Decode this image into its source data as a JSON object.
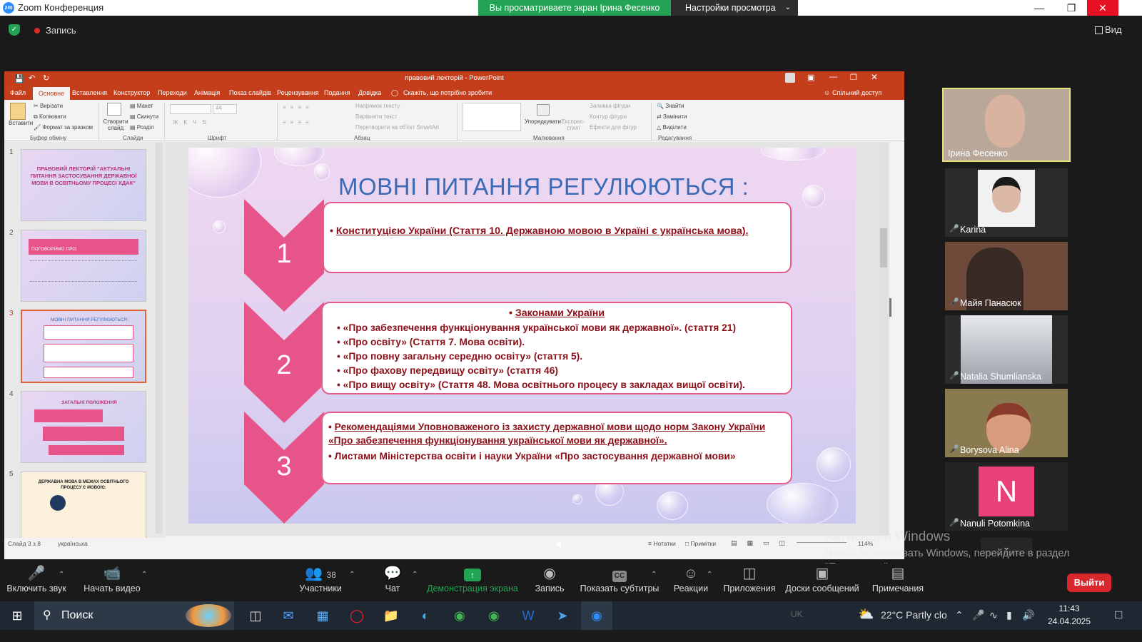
{
  "zoom": {
    "window_title": "Zoom Конференция",
    "share_banner": "Вы просматриваете экран Ірина Фесенко",
    "view_options": "Настройки просмотра",
    "record_label": "Запись",
    "view_label": "Вид",
    "leave_label": "Выйти",
    "toolbar": [
      {
        "label": "Включить звук",
        "icon": "microphone-muted-icon"
      },
      {
        "label": "Начать видео",
        "icon": "camera-off-icon"
      },
      {
        "label": "Участники",
        "icon": "participants-icon",
        "count": "38"
      },
      {
        "label": "Чат",
        "icon": "chat-icon"
      },
      {
        "label": "Демонстрация экрана",
        "icon": "share-screen-icon"
      },
      {
        "label": "Запись",
        "icon": "record-icon"
      },
      {
        "label": "Показать субтитры",
        "icon": "cc-icon",
        "badge": "CC"
      },
      {
        "label": "Реакции",
        "icon": "reactions-icon"
      },
      {
        "label": "Приложения",
        "icon": "apps-icon"
      },
      {
        "label": "Доски сообщений",
        "icon": "whiteboard-icon"
      },
      {
        "label": "Примечания",
        "icon": "notes-icon"
      }
    ],
    "participants": [
      {
        "name": "Ірина Фесенко",
        "active": true
      },
      {
        "name": "Karina"
      },
      {
        "name": "Майя Панасюк"
      },
      {
        "name": "Natalia Shumlianska"
      },
      {
        "name": "Borysova Alina"
      },
      {
        "name": "Nanuli Potomkina",
        "avatar_letter": "N"
      }
    ],
    "colors": {
      "share_green": "#23a455",
      "leave_red": "#d9272e",
      "avatar_pink": "#e8407a",
      "active_border": "#e6e67a"
    }
  },
  "ppt": {
    "title": "правовий лекторій - PowerPoint",
    "share_label": "Спільний доступ",
    "tabs": [
      "Файл",
      "Основне",
      "Вставлення",
      "Конструктор",
      "Переходи",
      "Анімація",
      "Показ слайдів",
      "Рецензування",
      "Подання",
      "Довідка",
      "Скажіть, що потрібно зробити"
    ],
    "active_tab": "Основне",
    "ribbon": {
      "clipboard": {
        "paste": "Вставити",
        "cut": "Вирізати",
        "copy": "Копіювати",
        "format": "Формат за зразком",
        "group": "Буфер обміну"
      },
      "slides": {
        "new": "Створити слайд",
        "layout": "Макет",
        "reset": "Скинути",
        "section": "Розділ",
        "group": "Слайди"
      },
      "font": {
        "size": "44",
        "group": "Шрифт"
      },
      "paragraph": {
        "direction": "Напрямок тексту",
        "align": "Вирівняти текст",
        "smartart": "Перетворити на об'єкт SmartArt",
        "group": "Абзац"
      },
      "drawing": {
        "arrange": "Упорядкувати",
        "styles": "Експрес-стилі",
        "fill": "Заливка фігури",
        "outline": "Контур фігури",
        "effects": "Ефекти для фігур",
        "group": "Малювання"
      },
      "editing": {
        "find": "Знайти",
        "replace": "Замінити",
        "select": "Виділити",
        "group": "Редагування"
      }
    },
    "thumbnails": [
      {
        "num": "1",
        "title": "ПРАВОВИЙ ЛЕКТОРІЙ \"АКТУАЛЬНІ ПИТАННЯ ЗАСТОСУВАННЯ ДЕРЖАВНОЇ МОВИ В ОСВІТНЬОМУ ПРОЦЕСІ ХДАК\""
      },
      {
        "num": "2",
        "title": "ПОГОВОРИМО ПРО:"
      },
      {
        "num": "3",
        "title": "МОВНІ ПИТАННЯ РЕГУЛЮЮТЬСЯ :"
      },
      {
        "num": "4",
        "title": "ЗАГАЛЬНІ ПОЛОЖЕННЯ"
      },
      {
        "num": "5",
        "title": "ДЕРЖАВНА МОВА В МЕЖАХ ОСВІТНЬОГО ПРОЦЕСУ Є МОВОЮ:"
      }
    ],
    "slide": {
      "title": "МОВНІ ПИТАННЯ РЕГУЛЮЮТЬСЯ :",
      "blocks": [
        {
          "num": "1",
          "lines": [
            "Конституцією України (Стаття 10. Державною мовою в Україні є українська мова)."
          ]
        },
        {
          "num": "2",
          "heading": "Законами України",
          "lines": [
            "«Про забезпечення функціонування української мови як державної». (стаття 21)",
            "«Про освіту» (Стаття 7. Мова освіти).",
            "«Про повну загальну середню освіту» (стаття 5).",
            "«Про фахову передвищу освіту»  (стаття 46)",
            "«Про вищу освіту» (Стаття 48. Мова освітнього процесу в закладах вищої освіти)."
          ]
        },
        {
          "num": "3",
          "lines": [
            "Рекомендаціями Уповноваженого із захисту державної мови щодо норм Закону України «Про забезпечення функціонування української мови як державної».",
            "Листами Міністерства освіти і науки України «Про застосування державної мови»"
          ]
        }
      ]
    },
    "status": {
      "slide_of": "Слайд 3 з 8",
      "language": "українська",
      "notes": "Нотатки",
      "comments": "Примітки",
      "zoom": "114%"
    }
  },
  "windows": {
    "activation_title": "Активация Windows",
    "activation_text": "Чтобы активировать Windows, перейдите в раздел \"Параметры\".",
    "search_placeholder": "Поиск",
    "weather": "22°C  Partly clo",
    "time": "11:43",
    "date": "24.04.2025",
    "lang": "UK"
  }
}
